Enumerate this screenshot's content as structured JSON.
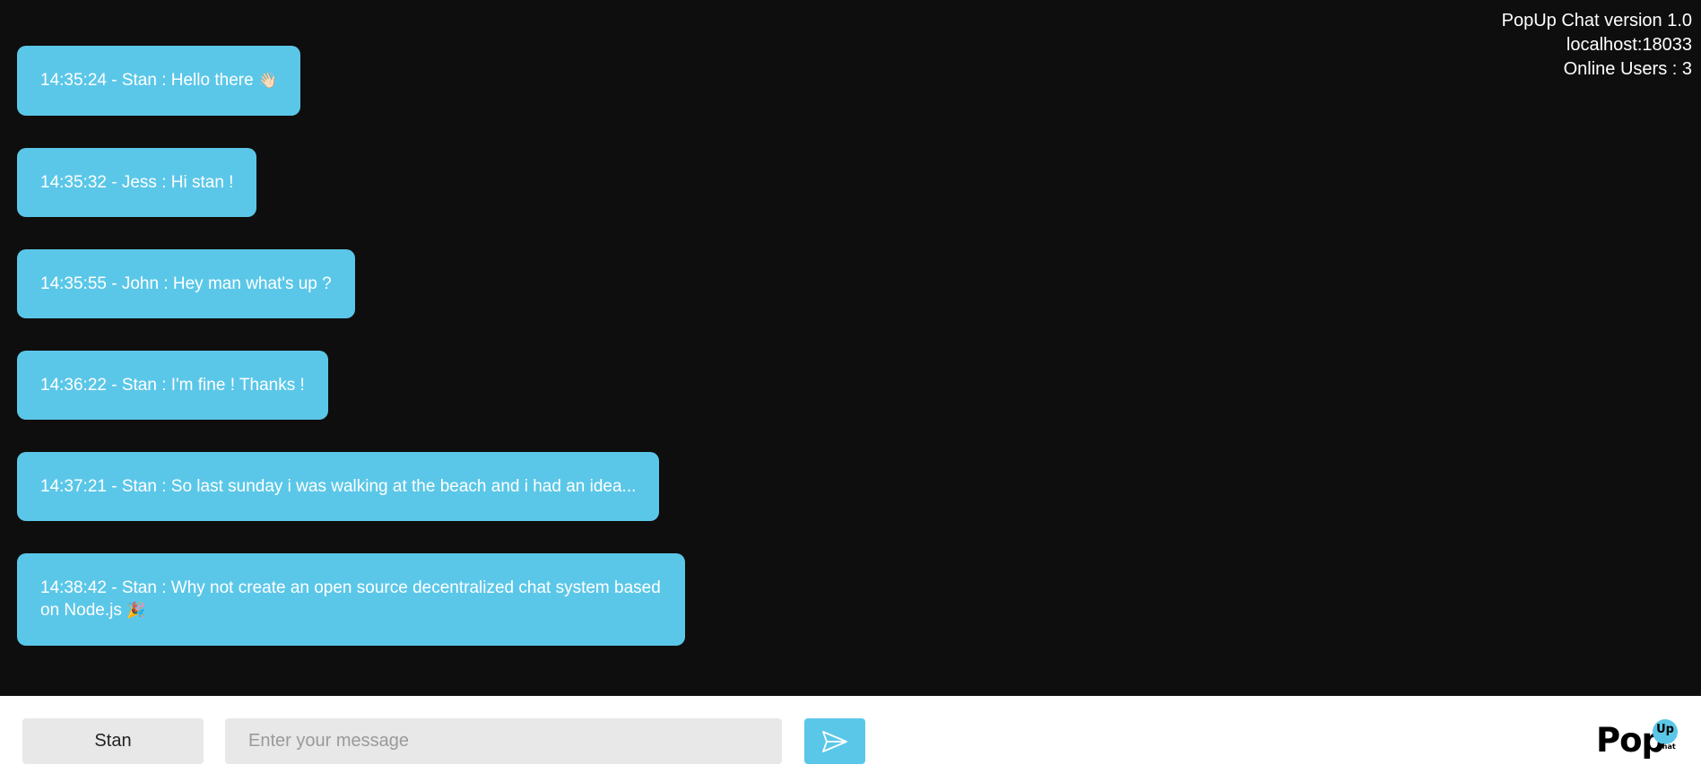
{
  "header": {
    "version": "PopUp Chat version 1.0",
    "host": "localhost:18033",
    "online_users": "Online Users : 3"
  },
  "messages": [
    {
      "text": "14:35:24 - Stan : Hello there",
      "emoji": "👋🏻"
    },
    {
      "text": "14:35:32 - Jess : Hi stan !",
      "emoji": ""
    },
    {
      "text": "14:35:55 - John : Hey man what's up ?",
      "emoji": ""
    },
    {
      "text": "14:36:22 - Stan : I'm fine ! Thanks !",
      "emoji": ""
    },
    {
      "text": "14:37:21 - Stan : So last sunday i was walking at the beach and i had an idea...",
      "emoji": ""
    },
    {
      "text": "14:38:42 - Stan : Why not create an open source decentralized chat system based on Node.js",
      "emoji": "🎉"
    }
  ],
  "footer": {
    "name_value": "Stan",
    "message_placeholder": "Enter your message",
    "send_icon": "send-icon",
    "logo": {
      "pop": "Pop",
      "up": "Up",
      "chat": "chat"
    }
  },
  "colors": {
    "background": "#0e0e0e",
    "bubble": "#5bc7e8",
    "footer": "#ffffff",
    "input": "#e8e8e8"
  }
}
